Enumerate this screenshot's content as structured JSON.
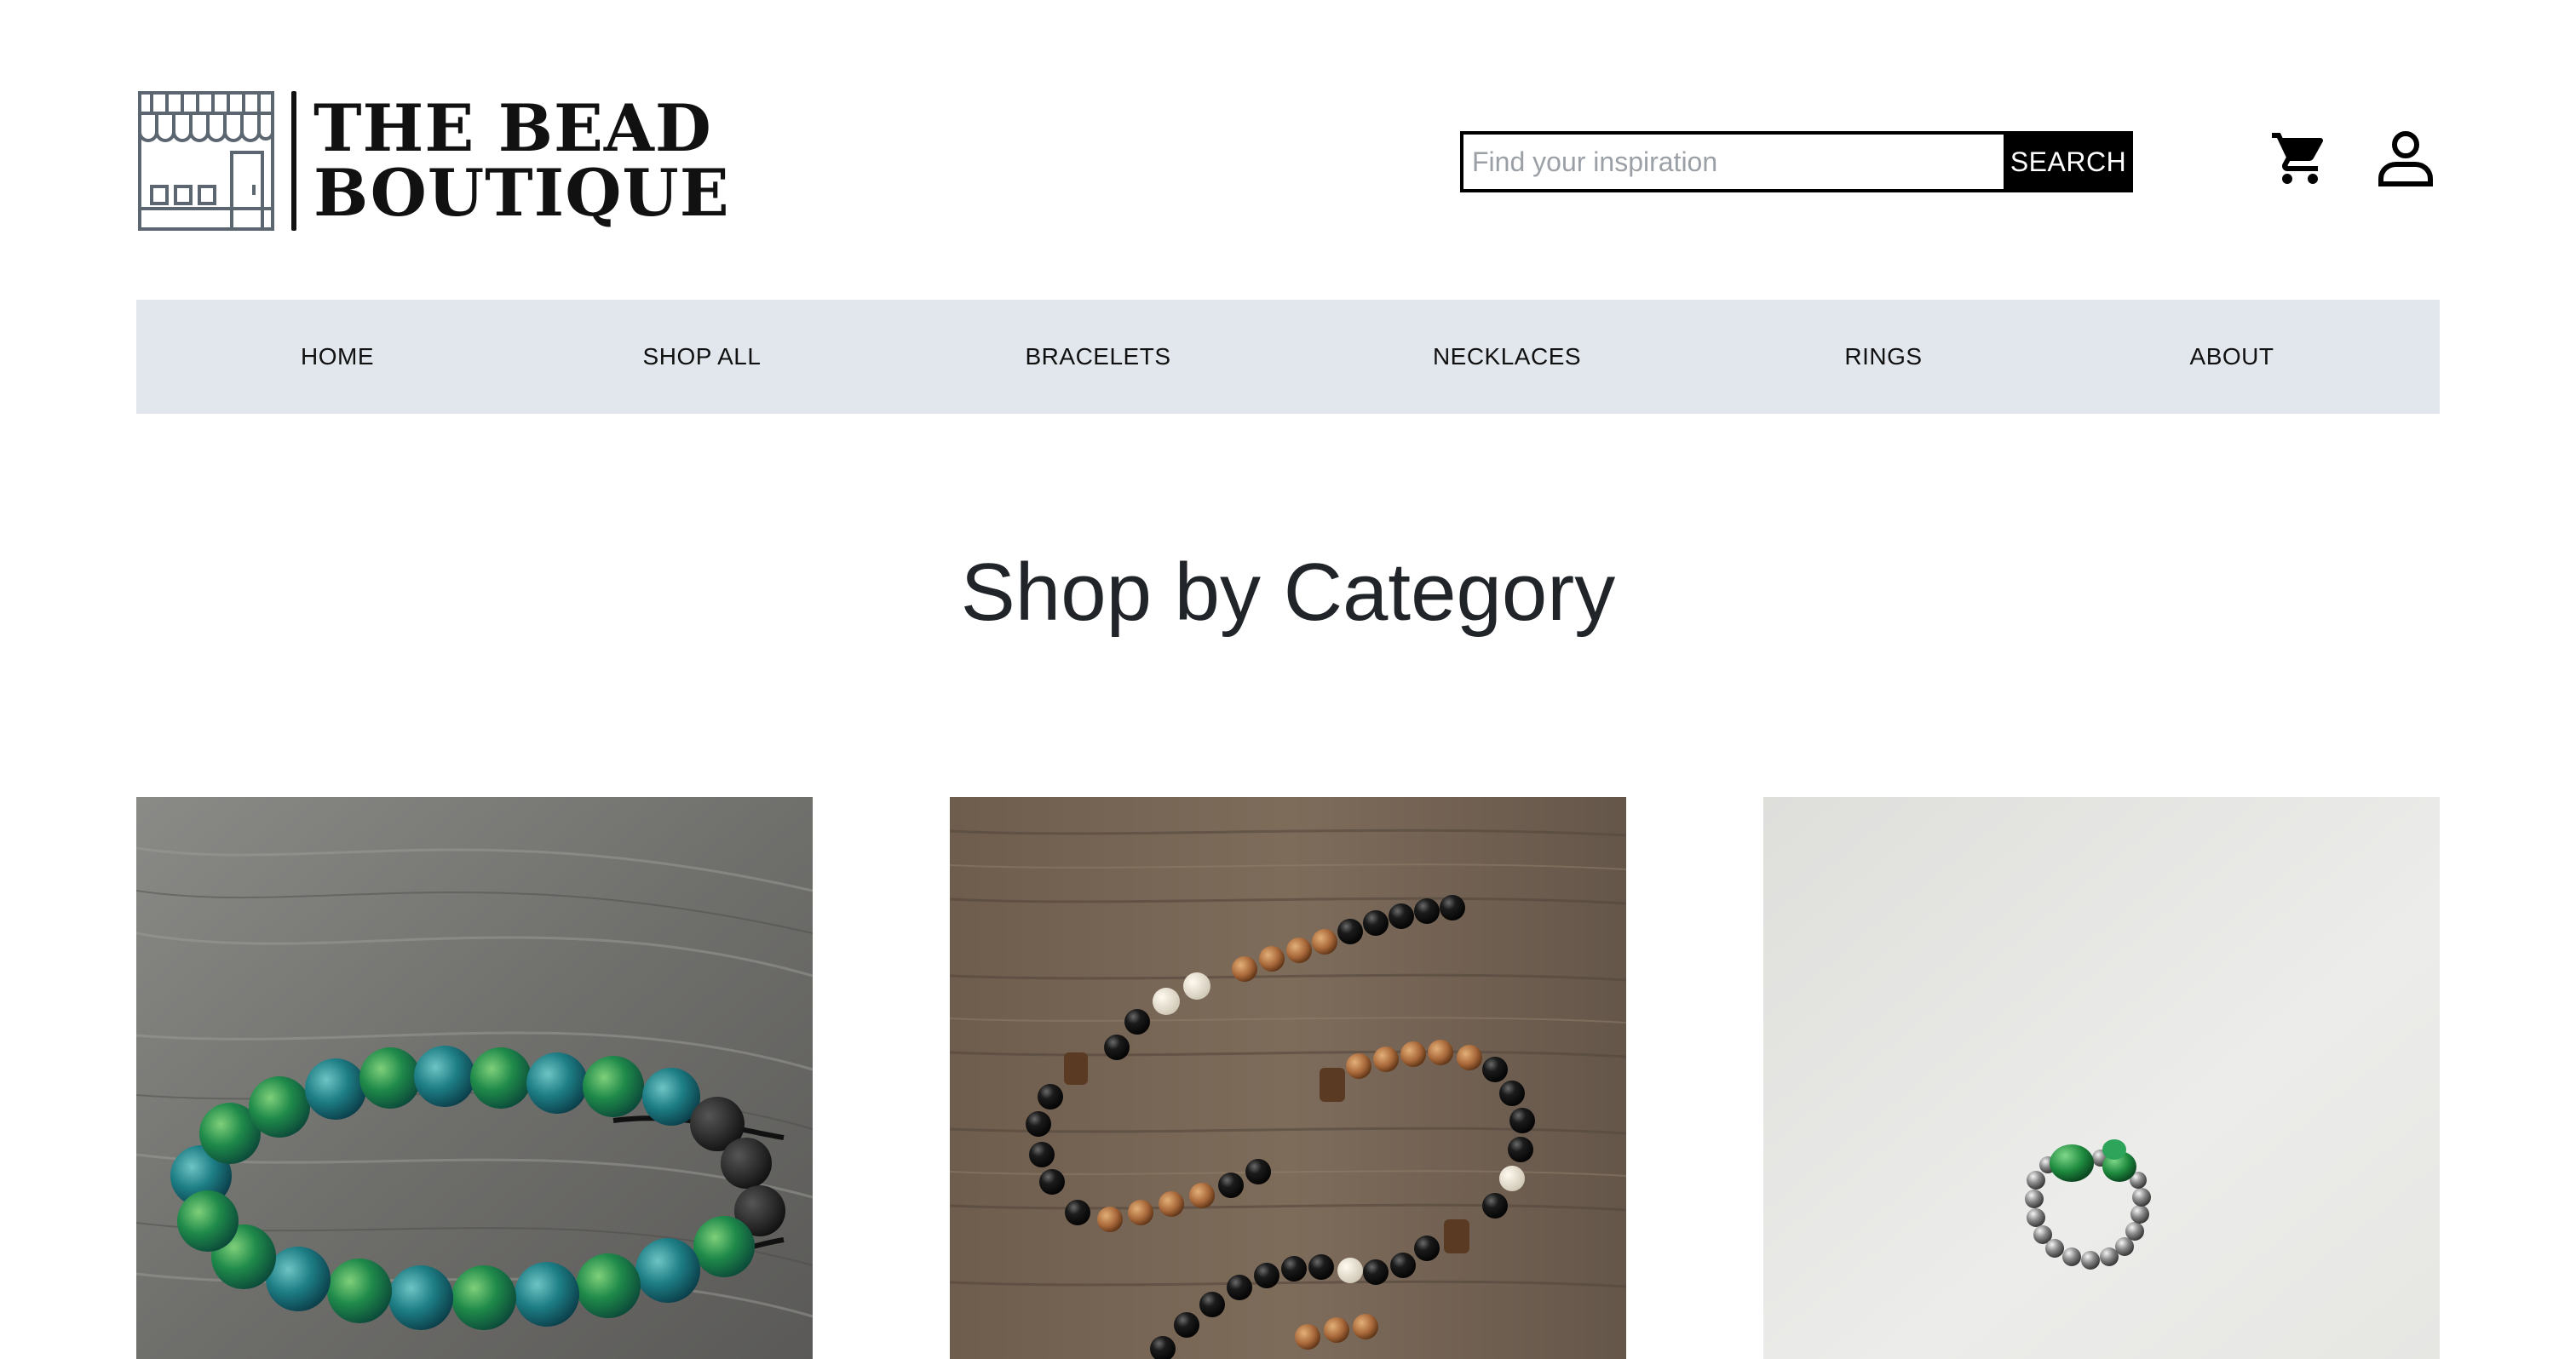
{
  "brand": {
    "line1": "THE BEAD",
    "line2": "BOUTIQUE",
    "logo_icon": "storefront-icon"
  },
  "search": {
    "placeholder": "Find your inspiration",
    "value": "",
    "button_label": "SEARCH"
  },
  "header_icons": {
    "cart": "shopping-cart-icon",
    "account": "user-account-icon"
  },
  "nav": {
    "items": [
      {
        "label": "HOME"
      },
      {
        "label": "SHOP ALL"
      },
      {
        "label": "BRACELETS"
      },
      {
        "label": "NECKLACES"
      },
      {
        "label": "RINGS"
      },
      {
        "label": "ABOUT"
      }
    ]
  },
  "main": {
    "heading": "Shop by Category"
  },
  "categories": [
    {
      "id": "bracelets",
      "image": "green-beaded-bracelet-on-wood"
    },
    {
      "id": "necklaces",
      "image": "black-and-wood-bead-necklace-on-wood"
    },
    {
      "id": "rings",
      "image": "silver-bead-ring-with-green-glass"
    }
  ],
  "colors": {
    "nav_background": "#e2e7ee",
    "button_background": "#000000",
    "text": "#212529"
  }
}
